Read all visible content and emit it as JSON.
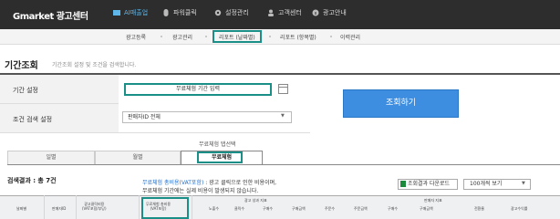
{
  "brand": {
    "logo": "Gmarket 광고센터"
  },
  "nav": [
    {
      "label": "AI매출업",
      "icon": "ai-sales-icon",
      "active": true
    },
    {
      "label": "파워클릭",
      "icon": "mouse-icon",
      "active": false
    },
    {
      "label": "설정관리",
      "icon": "settings-icon",
      "active": false
    },
    {
      "label": "고객센터",
      "icon": "user-icon",
      "active": false
    },
    {
      "label": "광고안내",
      "icon": "info-icon",
      "active": false
    }
  ],
  "submenu": [
    "광고등록",
    "광고관리",
    "리포트 (날짜별)",
    "리포트 (항목별)",
    "이력관리"
  ],
  "page": {
    "title": "기간조회",
    "desc": "기간조회 설정 및 조건을 검색합니다."
  },
  "filter": {
    "period_label": "기간 설정",
    "period_value": "무료체험 기간 입력",
    "condition_label": "조건 검색 설정",
    "condition_value": "판매자ID 전체",
    "search_button": "조회하기"
  },
  "tabs": {
    "tip": "무료체험 탭선택",
    "items": [
      "일별",
      "월별",
      "무료체험"
    ],
    "active_index": 2
  },
  "results": {
    "heading": "검색결과 : 총 7건",
    "annotation_line1_blue": "무료체험 총비용(VAT포함)",
    "annotation_line1_rest": ": 광고 클릭으로 인한 비용이며,",
    "annotation_line2": "무료체험 기간에는 실제 비용이 발생되지 않습니다.",
    "download_button": "조회결과 다운로드",
    "view_select": "100개씩 보기"
  },
  "table": {
    "group_headers": [
      "광고 성과 지표",
      "판매자 지표"
    ],
    "columns": [
      "날짜별",
      "판매자ID",
      "광고클릭비용\n(VAT포함/부당)",
      "무료체험 총비용\n(VAT포함)",
      "노출수",
      "클릭수",
      "구매수",
      "구매금액",
      "주문수",
      "주문금액",
      "구매수",
      "구매금액",
      "전환율",
      "광고수익률"
    ]
  },
  "colors": {
    "highlight": "#1a8f87",
    "primary": "#3d8ee0",
    "nav_bg": "#2d2d2d"
  }
}
